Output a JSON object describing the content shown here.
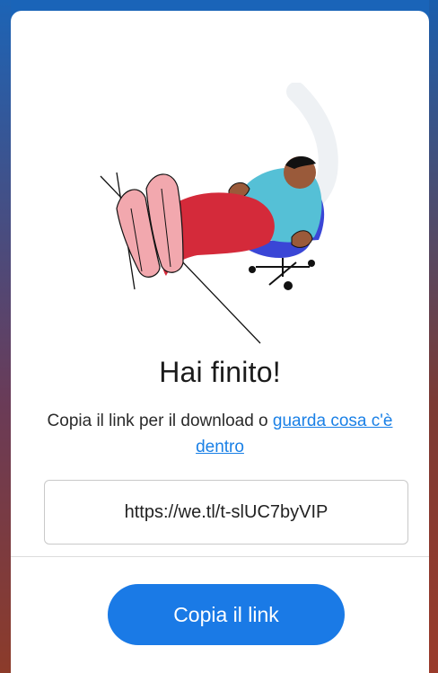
{
  "dialog": {
    "title": "Hai finito!",
    "message_prefix": "Copia il link per il download o ",
    "message_link": "guarda cosa c'è dentro",
    "link_value": "https://we.tl/t-slUC7byVIP",
    "copy_button_label": "Copia il link"
  },
  "colors": {
    "accent": "#1a7ae6",
    "link": "#1a80e6",
    "background_top": "#1a64b8",
    "background_bottom": "#8a3a2a"
  },
  "illustration": {
    "icon": "person-relaxing-in-chair-illustration"
  }
}
